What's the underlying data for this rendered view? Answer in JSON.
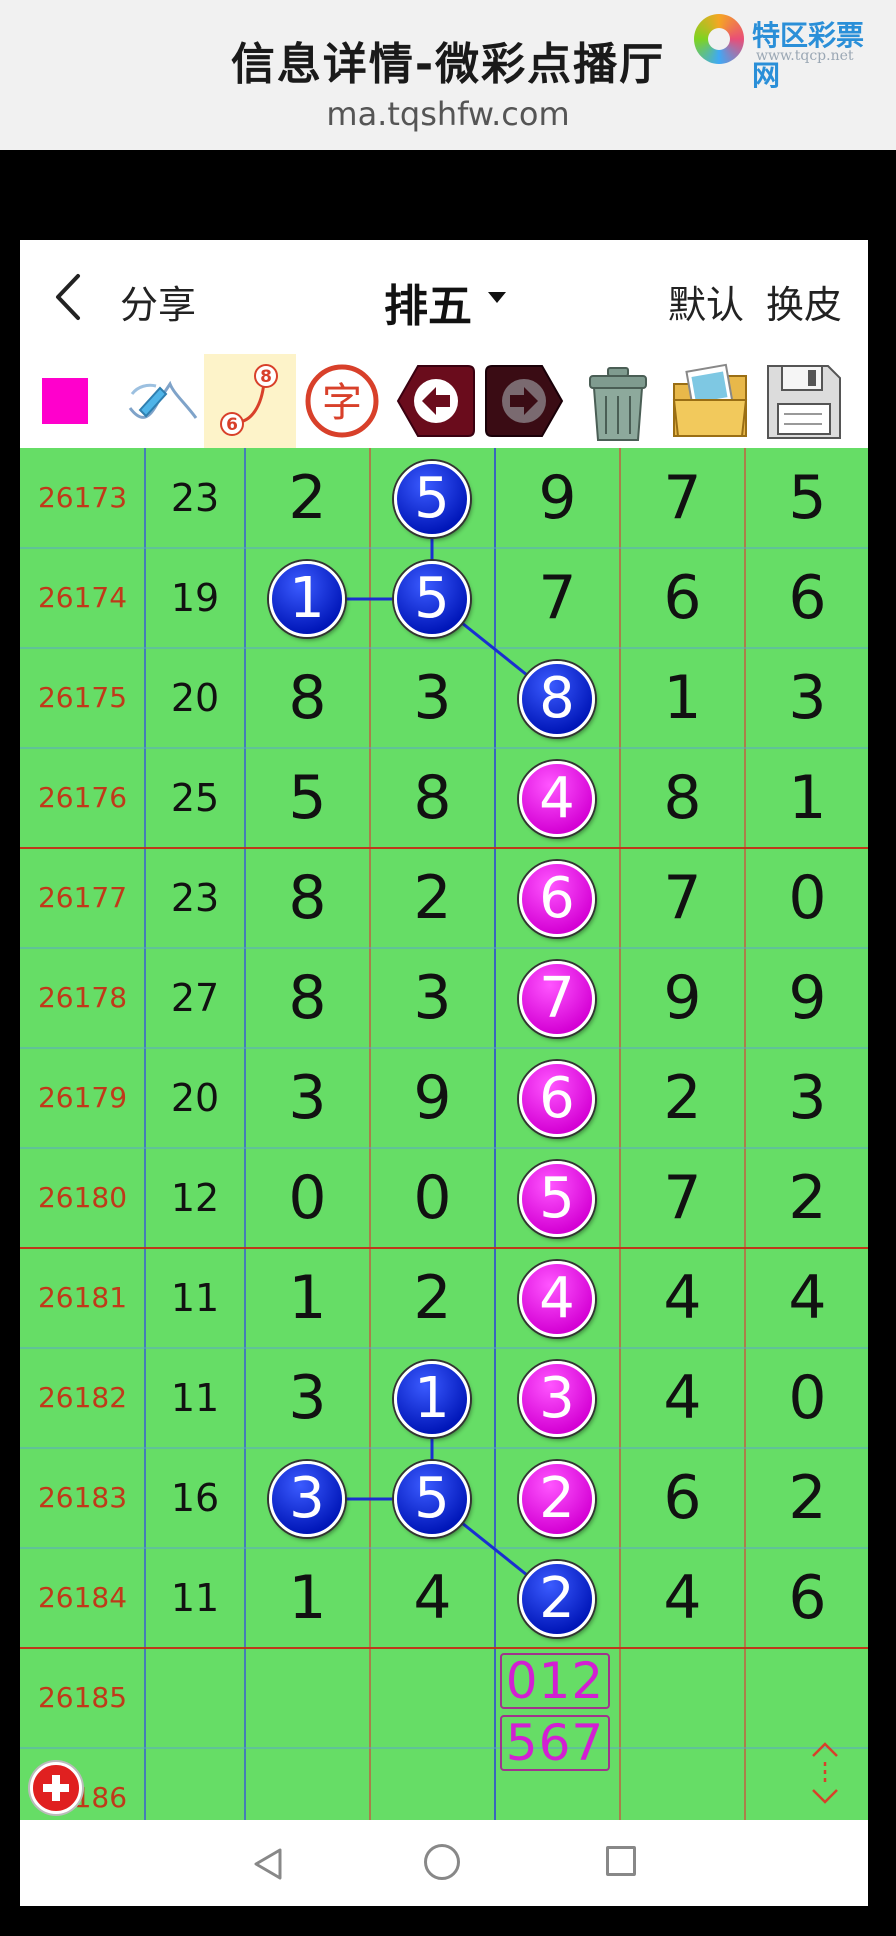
{
  "browser": {
    "title": "信息详情-微彩点播厅",
    "url": "ma.tqshfw.com",
    "logo_name": "特区彩票网",
    "logo_url": "www.tqcp.net"
  },
  "navbar": {
    "back_icon": "chevron-left-icon",
    "share_label": "分享",
    "lottery_label": "排五",
    "default_label": "默认",
    "skin_label": "换皮"
  },
  "toolbar": {
    "color_swatch": "#ff00cc",
    "tools": [
      "color-swatch",
      "pen-icon",
      "connect-icon",
      "text-icon",
      "undo-icon",
      "redo-icon",
      "trash-icon",
      "gallery-icon",
      "save-icon"
    ],
    "connect_labels": [
      "6",
      "8"
    ],
    "text_tool_label": "字"
  },
  "rows": [
    {
      "issue": "26173",
      "sum": "23",
      "d": [
        "2",
        "5",
        "9",
        "7",
        "5"
      ]
    },
    {
      "issue": "26174",
      "sum": "19",
      "d": [
        "1",
        "5",
        "7",
        "6",
        "6"
      ]
    },
    {
      "issue": "26175",
      "sum": "20",
      "d": [
        "8",
        "3",
        "8",
        "1",
        "3"
      ]
    },
    {
      "issue": "26176",
      "sum": "25",
      "d": [
        "5",
        "8",
        "4",
        "8",
        "1"
      ]
    },
    {
      "issue": "26177",
      "sum": "23",
      "d": [
        "8",
        "2",
        "6",
        "7",
        "0"
      ]
    },
    {
      "issue": "26178",
      "sum": "27",
      "d": [
        "8",
        "3",
        "7",
        "9",
        "9"
      ]
    },
    {
      "issue": "26179",
      "sum": "20",
      "d": [
        "3",
        "9",
        "6",
        "2",
        "3"
      ]
    },
    {
      "issue": "26180",
      "sum": "12",
      "d": [
        "0",
        "0",
        "5",
        "7",
        "2"
      ]
    },
    {
      "issue": "26181",
      "sum": "11",
      "d": [
        "1",
        "2",
        "4",
        "4",
        "4"
      ]
    },
    {
      "issue": "26182",
      "sum": "11",
      "d": [
        "3",
        "1",
        "3",
        "4",
        "0"
      ]
    },
    {
      "issue": "26183",
      "sum": "16",
      "d": [
        "3",
        "5",
        "2",
        "6",
        "2"
      ]
    },
    {
      "issue": "26184",
      "sum": "11",
      "d": [
        "1",
        "4",
        "2",
        "4",
        "6"
      ]
    },
    {
      "issue": "26185",
      "sum": "",
      "d": [
        "",
        "",
        "",
        "",
        ""
      ]
    },
    {
      "issue": "26186",
      "sum": "",
      "d": [
        "",
        "",
        "",
        "",
        ""
      ]
    }
  ],
  "marks": [
    {
      "row": 0,
      "col": 1,
      "color": "blue"
    },
    {
      "row": 1,
      "col": 0,
      "color": "blue"
    },
    {
      "row": 1,
      "col": 1,
      "color": "blue"
    },
    {
      "row": 2,
      "col": 2,
      "color": "blue"
    },
    {
      "row": 3,
      "col": 2,
      "color": "pink"
    },
    {
      "row": 4,
      "col": 2,
      "color": "pink"
    },
    {
      "row": 5,
      "col": 2,
      "color": "pink"
    },
    {
      "row": 6,
      "col": 2,
      "color": "pink"
    },
    {
      "row": 7,
      "col": 2,
      "color": "pink"
    },
    {
      "row": 8,
      "col": 2,
      "color": "pink"
    },
    {
      "row": 9,
      "col": 1,
      "color": "blue"
    },
    {
      "row": 9,
      "col": 2,
      "color": "pink"
    },
    {
      "row": 10,
      "col": 0,
      "color": "blue"
    },
    {
      "row": 10,
      "col": 1,
      "color": "blue"
    },
    {
      "row": 10,
      "col": 2,
      "color": "pink"
    },
    {
      "row": 11,
      "col": 2,
      "color": "blue"
    }
  ],
  "connectors": [
    [
      [
        0,
        1
      ],
      [
        1,
        1
      ]
    ],
    [
      [
        1,
        0
      ],
      [
        1,
        1
      ]
    ],
    [
      [
        1,
        1
      ],
      [
        2,
        2
      ]
    ],
    [
      [
        9,
        1
      ],
      [
        10,
        1
      ]
    ],
    [
      [
        10,
        0
      ],
      [
        10,
        1
      ]
    ],
    [
      [
        10,
        1
      ],
      [
        11,
        2
      ]
    ]
  ],
  "predictions": [
    "012",
    "567"
  ],
  "colors": {
    "grid_bg": "#66dd66",
    "issue_text": "#c0391a",
    "ball_blue": "#0016b8",
    "ball_pink": "#d400d4",
    "prediction": "#d21fd2",
    "add_button": "#e02020"
  },
  "system_nav": {
    "back_icon": "triangle-back-icon",
    "home_icon": "circle-home-icon",
    "recent_icon": "square-recent-icon"
  }
}
